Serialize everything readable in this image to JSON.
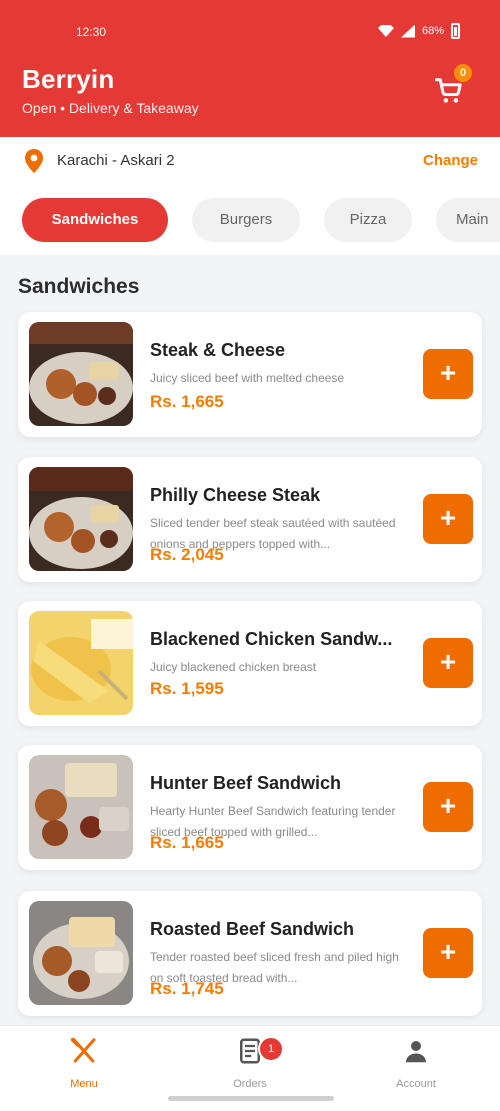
{
  "status_bar": {
    "time": "12:30",
    "battery": "68%"
  },
  "header": {
    "title": "Berryin",
    "subtitle": "Open • Delivery & Takeaway",
    "cart_count": "0"
  },
  "location": {
    "address": "Karachi - Askari 2",
    "change_label": "Change"
  },
  "tabs": [
    {
      "label": "Sandwiches",
      "active": true
    },
    {
      "label": "Burgers",
      "active": false
    },
    {
      "label": "Pizza",
      "active": false
    },
    {
      "label": "Main",
      "active": false
    }
  ],
  "section": {
    "title": "Sandwiches"
  },
  "items": [
    {
      "name": "Steak & Cheese",
      "description": "Juicy sliced beef with melted cheese",
      "price": "Rs. 1,665",
      "add_label": "+"
    },
    {
      "name": "Philly Cheese Steak",
      "description": "Sliced tender beef steak sautéed with sautéed onions and peppers topped with...",
      "price": "Rs. 2,045",
      "add_label": "+"
    },
    {
      "name": "Blackened Chicken Sandw...",
      "description": "Juicy blackened chicken breast",
      "price": "Rs. 1,595",
      "add_label": "+"
    },
    {
      "name": "Hunter Beef Sandwich",
      "description": "Hearty Hunter Beef Sandwich featuring tender sliced beef topped with grilled...",
      "price": "Rs. 1,665",
      "add_label": "+"
    },
    {
      "name": "Roasted Beef Sandwich",
      "description": "Tender roasted beef sliced fresh and piled high on soft toasted bread with...",
      "price": "Rs. 1,745",
      "add_label": "+"
    }
  ],
  "bottom_nav": {
    "menu": "Menu",
    "orders": "Orders",
    "orders_badge": "1",
    "account": "Account"
  },
  "colors": {
    "brand_red": "#e53935",
    "accent_orange": "#ef6c00",
    "price_orange": "#f57c00"
  }
}
